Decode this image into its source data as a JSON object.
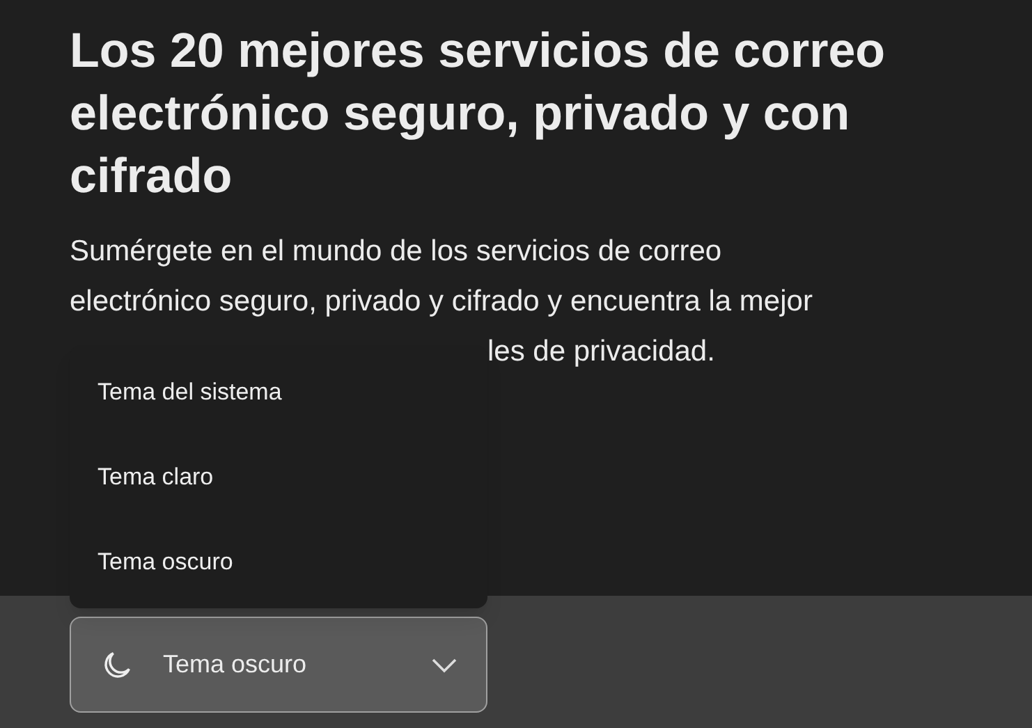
{
  "article": {
    "title": "Los 20 mejores servicios de correo electrónico seguro, privado y con cifrado",
    "description_lines": [
      "Sumérgete en el mundo de los servicios de correo",
      "electrónico seguro, privado y cifrado y encuentra la mejor",
      "les de privacidad."
    ]
  },
  "theme_menu": {
    "expanded": true,
    "options": [
      "Tema del sistema",
      "Tema claro",
      "Tema oscuro"
    ]
  },
  "theme_select": {
    "value": "Tema oscuro"
  }
}
